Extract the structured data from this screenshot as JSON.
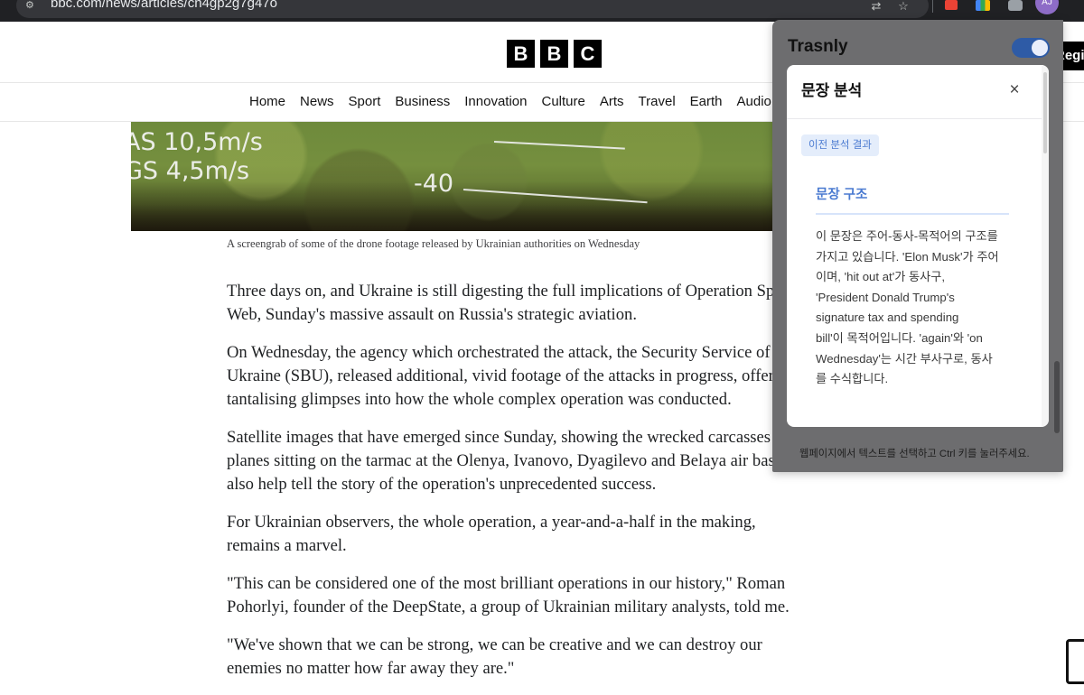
{
  "browser": {
    "url": "bbc.com/news/articles/cn4gp2g7g47o",
    "profile_initials": "AJ"
  },
  "site": {
    "logo_letters": [
      "B",
      "B",
      "C"
    ],
    "register_label": "Register",
    "nav": [
      "Home",
      "News",
      "Sport",
      "Business",
      "Innovation",
      "Culture",
      "Arts",
      "Travel",
      "Earth",
      "Audio"
    ]
  },
  "hero": {
    "hud_1": "AS 10,5m/s",
    "hud_2": "GS 4,5m/s",
    "hud_3": "-40",
    "caption": "A screengrab of some of the drone footage released by Ukrainian authorities on Wednesday"
  },
  "article": {
    "paragraphs": [
      [
        "Three days on, and Ukraine is still digesting the full implications of Operation Spider's",
        "Web, Sunday's massive assault on Russia's strategic aviation."
      ],
      [
        "On Wednesday, the agency which orchestrated the attack, the Security Service of",
        "Ukraine (SBU), released additional, vivid footage of the attacks in progress, offering",
        "tantalising glimpses into how the whole complex operation was conducted."
      ],
      [
        "Satellite images that have emerged since Sunday, showing the wrecked carcasses of",
        "planes sitting on the tarmac at the Olenya, Ivanovo, Dyagilevo and Belaya air bases,",
        "also help tell the story of the operation's unprecedented success."
      ],
      [
        "For Ukrainian observers, the whole operation, a year-and-a-half in the making,",
        "remains a marvel."
      ],
      [
        "\"This can be considered one of the most brilliant operations in our history,\" Roman",
        "Pohorlyi, founder of the DeepState, a group of Ukrainian military analysts, told me."
      ],
      [
        "\"We've shown that we can be strong, we can be creative and we can destroy our",
        "enemies no matter how far away they are.\""
      ]
    ]
  },
  "extension": {
    "name": "Trasnly",
    "toggle_on": true,
    "modal": {
      "title": "문장 분석",
      "close": "×",
      "prev_chip": "이전 분석 결과",
      "section_title": "문장 구조",
      "body_lines": [
        "이 문장은 주어-동사-목적어의 구조를",
        "가지고 있습니다. 'Elon Musk'가 주어",
        "이며, 'hit out at'가 동사구,",
        "'President Donald Trump's",
        "signature tax and spending",
        "bill'이 목적어입니다. 'again'와 'on",
        "Wednesday'는 시간 부사구로, 동사",
        "를 수식합니다."
      ]
    },
    "footer_hint": "웹페이지에서 텍스트를 선택하고 Ctrl 키를 눌러주세요."
  },
  "colors": {
    "accent_blue": "#4b7bd1",
    "toggle_blue": "#2e5ba6",
    "bbc_black": "#000000"
  }
}
